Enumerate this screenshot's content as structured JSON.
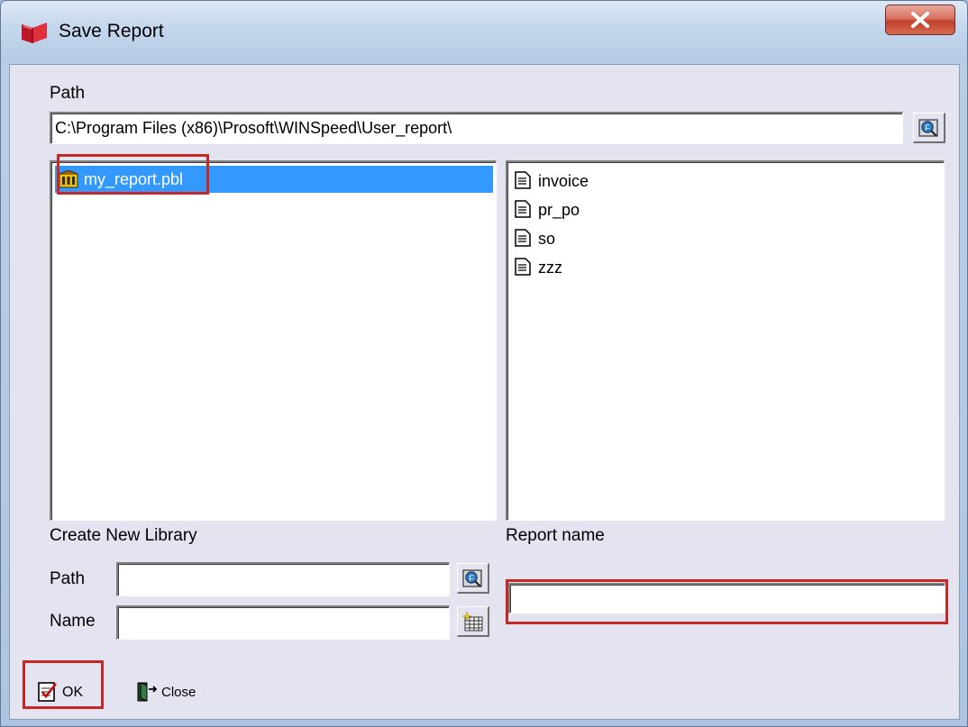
{
  "window": {
    "title": "Save Report",
    "title_icon": "red-book-icon",
    "close_icon": "close-x-icon"
  },
  "path_section": {
    "label": "Path",
    "value": "C:\\Program Files (x86)\\Prosoft\\WINSpeed\\User_report\\",
    "browse_icon": "browse-folder-icon"
  },
  "libraries": {
    "items": [
      {
        "label": "my_report.pbl",
        "icon": "library-icon",
        "selected": true
      }
    ]
  },
  "reports": {
    "items": [
      {
        "label": "invoice",
        "icon": "document-icon"
      },
      {
        "label": "pr_po",
        "icon": "document-icon"
      },
      {
        "label": "so",
        "icon": "document-icon"
      },
      {
        "label": "zzz",
        "icon": "document-icon"
      }
    ]
  },
  "create_library": {
    "heading": "Create New Library",
    "path_label": "Path",
    "path_value": "",
    "name_label": "Name",
    "name_value": "",
    "path_browse_icon": "browse-folder-icon",
    "new_library_icon": "new-library-icon"
  },
  "report_name": {
    "label": "Report name",
    "value": ""
  },
  "buttons": {
    "ok_label": "OK",
    "ok_icon": "checklist-icon",
    "close_label": "Close",
    "close_icon": "exit-door-icon"
  },
  "colors": {
    "selection": "#3399ff",
    "highlight_box": "#c62828",
    "dialog_face": "#e4e4f0"
  }
}
